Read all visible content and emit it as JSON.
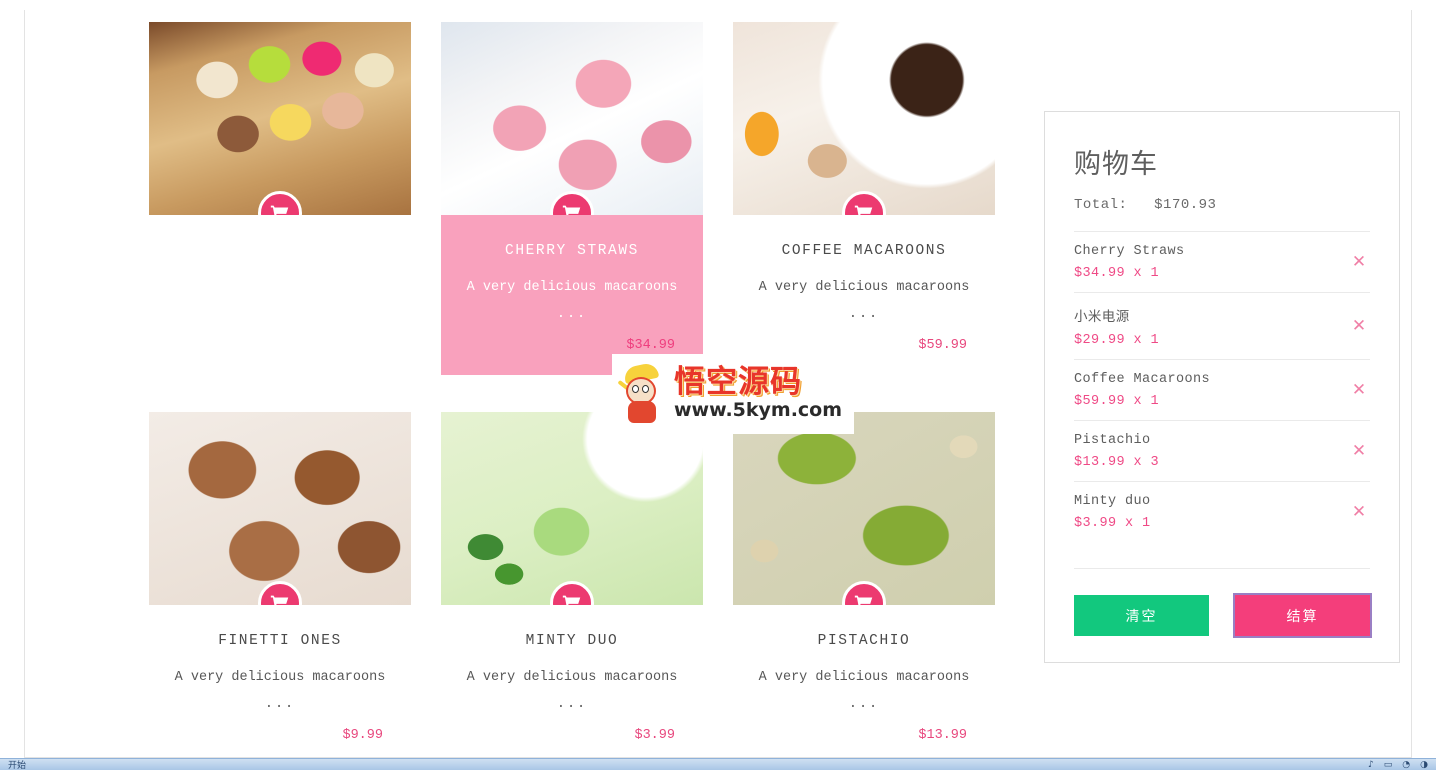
{
  "products": [
    {
      "id": "assorted",
      "title": "",
      "desc": "",
      "dots": "",
      "price": "",
      "photo": "ph-assorted",
      "hovered": false,
      "has_text": false,
      "cart_icon": "shopping-cart-icon"
    },
    {
      "id": "cherry-straws",
      "title": "CHERRY STRAWS",
      "desc": "A very delicious macaroons",
      "dots": "...",
      "price": "$34.99",
      "photo": "ph-pink",
      "hovered": true,
      "has_text": true,
      "cart_icon": "shopping-cart-icon"
    },
    {
      "id": "coffee-macaroons",
      "title": "COFFEE MACAROONS",
      "desc": "A very delicious macaroons",
      "dots": "...",
      "price": "$59.99",
      "photo": "ph-coffee",
      "hovered": false,
      "has_text": true,
      "cart_icon": "shopping-cart-icon"
    },
    {
      "id": "finetti-ones",
      "title": "FINETTI ONES",
      "desc": "A very delicious macaroons",
      "dots": "...",
      "price": "$9.99",
      "photo": "ph-choco",
      "hovered": false,
      "has_text": true,
      "cart_icon": "shopping-cart-icon"
    },
    {
      "id": "minty-duo",
      "title": "MINTY DUO",
      "desc": "A very delicious macaroons",
      "dots": "...",
      "price": "$3.99",
      "photo": "ph-mint",
      "hovered": false,
      "has_text": true,
      "cart_icon": "shopping-cart-icon"
    },
    {
      "id": "pistachio",
      "title": "PISTACHIO",
      "desc": "A very delicious macaroons",
      "dots": "...",
      "price": "$13.99",
      "photo": "ph-pistachio",
      "hovered": false,
      "has_text": true,
      "cart_icon": "shopping-cart-icon"
    }
  ],
  "cart": {
    "title": "购物车",
    "total_label": "Total:",
    "total_value": "$170.93",
    "remove_glyph": "✕",
    "items": [
      {
        "name": "Cherry Straws",
        "price": "$34.99",
        "qty": "x 1",
        "sub": "$34.99 x 1"
      },
      {
        "name": "小米电源",
        "price": "$29.99",
        "qty": "x 1",
        "sub": "$29.99 x 1"
      },
      {
        "name": "Coffee Macaroons",
        "price": "$59.99",
        "qty": "x 1",
        "sub": "$59.99 x 1"
      },
      {
        "name": "Pistachio",
        "price": "$13.99",
        "qty": "x 3",
        "sub": "$13.99 x 3"
      },
      {
        "name": "Minty duo",
        "price": "$3.99",
        "qty": "x 1",
        "sub": "$3.99 x 1"
      }
    ],
    "clear_label": "清空",
    "checkout_label": "结算"
  },
  "watermark": {
    "cn_text": "悟空源码",
    "url_text": "www.5kym.com"
  },
  "colors": {
    "accent_pink": "#ec3a70",
    "price_pink": "#e8487e",
    "hover_overlay": "#f9a1bd",
    "clear_green": "#12c87e",
    "checkout_pink": "#f43e7b",
    "focus_purple": "#9a7fc4"
  },
  "taskbar": {
    "left_items": [
      "开始"
    ],
    "right_items": [
      "♪",
      "▭",
      "◔",
      "◑"
    ]
  }
}
